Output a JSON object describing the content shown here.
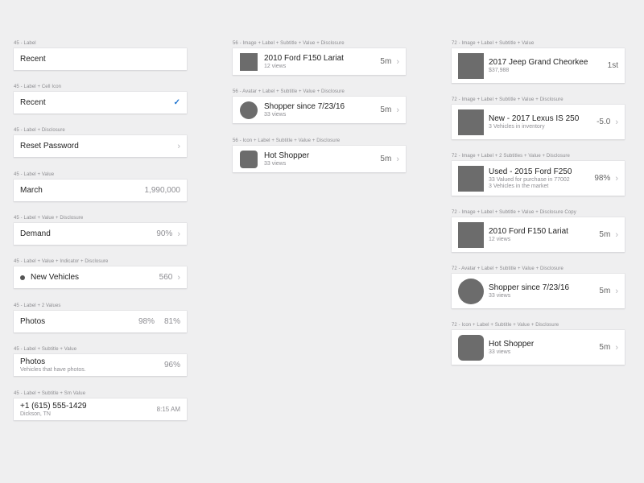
{
  "col1": [
    {
      "caption": "45 - Label",
      "label": "Recent"
    },
    {
      "caption": "45 - Label + Cell Icon",
      "label": "Recent",
      "icon": "checkmark-icon"
    },
    {
      "caption": "45 - Label + Disclosure",
      "label": "Reset Password"
    },
    {
      "caption": "45 - Label + Value",
      "label": "March",
      "value": "1,990,000"
    },
    {
      "caption": "45 - Label + Value + Disclosure",
      "label": "Demand",
      "value": "90%"
    },
    {
      "caption": "45 - Label + Value + Indicator + Disclosure",
      "label": "New Vehicles",
      "value": "560"
    },
    {
      "caption": "45 - Label + 2 Values",
      "label": "Photos",
      "value1": "98%",
      "value2": "81%"
    },
    {
      "caption": "45 - Label + Subtitle + Value",
      "label": "Photos",
      "subtitle": "Vehicles that have photos.",
      "value": "96%"
    },
    {
      "caption": "45 - Label + Subtitle + Sm Value",
      "label": "+1 (615) 555-1429",
      "subtitle": "Dickson, TN",
      "value": "8:15 AM"
    }
  ],
  "col2": [
    {
      "caption": "56 - Image + Label + Subtitle + Value + Disclosure",
      "label": "2010 Ford F150 Lariat",
      "subtitle": "12 views",
      "value": "5m"
    },
    {
      "caption": "56 - Avatar + Label + Subtitle + Value + Disclosure",
      "label": "Shopper since 7/23/16",
      "subtitle": "33 views",
      "value": "5m"
    },
    {
      "caption": "56 - Icon + Label + Subtitle + Value + Disclosure",
      "label": "Hot Shopper",
      "subtitle": "33 views",
      "value": "5m"
    }
  ],
  "col3": [
    {
      "caption": "72 - Image + Label + Subtitle + Value",
      "label": "2017 Jeep Grand Cheorkee",
      "subtitle": "$37,988",
      "value": "1st"
    },
    {
      "caption": "72 - Image + Label + Subtitle + Value + Disclosure",
      "label": "New - 2017 Lexus IS 250",
      "subtitle": "3 Vehicles in inventory",
      "value": "-5.0"
    },
    {
      "caption": "72 - Image + Label + 2 Subtitles + Value + Disclosure",
      "label": "Used - 2015 Ford F250",
      "subtitle": "33 Valued for purchase in 77002",
      "subtitle2": "3 Vehicles in the market",
      "value": "98%"
    },
    {
      "caption": "72 - Image + Label + Subtitle + Value + Disclosure Copy",
      "label": "2010 Ford F150 Lariat",
      "subtitle": "12 views",
      "value": "5m"
    },
    {
      "caption": "72 - Avatar + Label + Subtitle + Value + Disclosure",
      "label": "Shopper since 7/23/16",
      "subtitle": "33 views",
      "value": "5m"
    },
    {
      "caption": "72 - Icon + Label + Subtitle + Value + Disclosure",
      "label": "Hot Shopper",
      "subtitle": "33 views",
      "value": "5m"
    }
  ],
  "colors": {
    "accent": "#1f74d0",
    "background": "#efeff0",
    "thumb": "#6c6c6c"
  },
  "icons": {
    "disclosure": "chevron-right-icon",
    "check": "checkmark-icon",
    "indicator": "status-dot-icon"
  }
}
